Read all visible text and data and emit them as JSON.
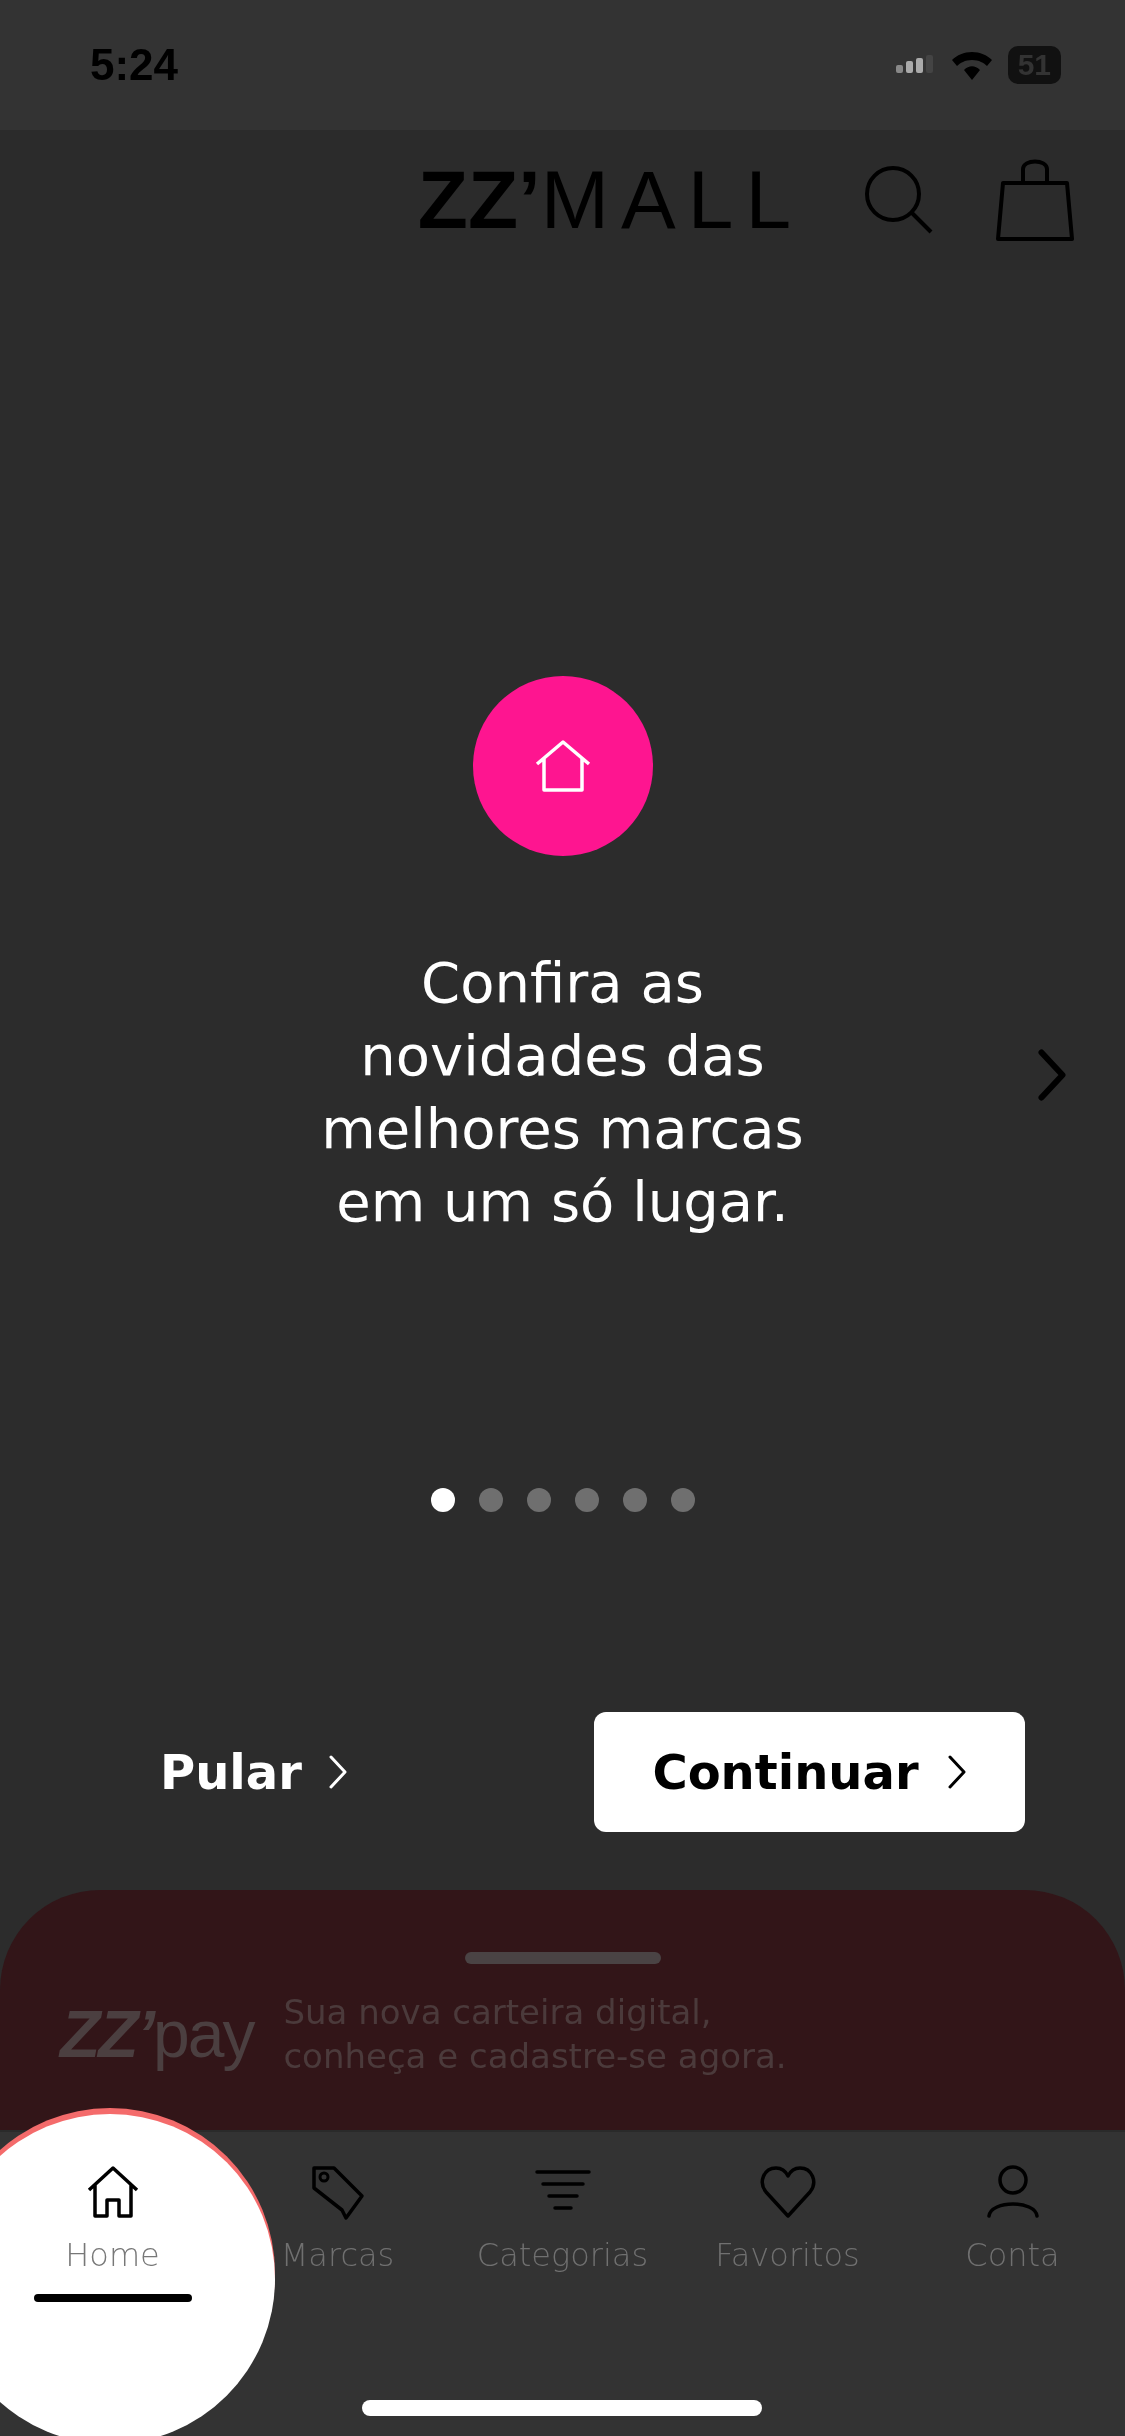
{
  "status_bar": {
    "time": "5:24",
    "battery": "51"
  },
  "header": {
    "logo": "**ZZ’**MALL"
  },
  "onboarding": {
    "message": "Confira as novidades das melhores marcas em um só lugar.",
    "dots": [
      {
        "selected": true
      },
      {
        "selected": false
      },
      {
        "selected": false
      },
      {
        "selected": false
      },
      {
        "selected": false
      },
      {
        "selected": false
      }
    ],
    "skip": "Pular",
    "continue": "Continuar"
  },
  "pay_banner": {
    "logo": "**ZZ’**pay",
    "text": "Sua nova carteira digital, conheça e cadastre-se agora."
  },
  "tabs": [
    {
      "label": "Home",
      "kind": "home",
      "selected": true
    },
    {
      "label": "Marcas",
      "kind": "tag",
      "selected": false
    },
    {
      "label": "Categorias",
      "kind": "filter",
      "selected": false
    },
    {
      "label": "Favoritos",
      "kind": "heart",
      "selected": false
    },
    {
      "label": "Conta",
      "kind": "person",
      "selected": false
    }
  ]
}
